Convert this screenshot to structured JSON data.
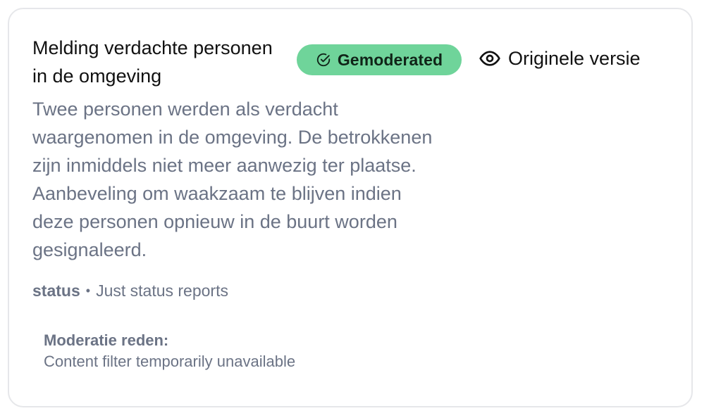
{
  "card": {
    "title": "Melding verdachte personen in de omgeving",
    "badge": {
      "label": "Gemoderated",
      "icon": "check-circle-icon",
      "color": "#6fd49a"
    },
    "original_link": {
      "label": "Originele versie",
      "icon": "eye-icon"
    },
    "body": "Twee personen werden als verdacht waargenomen in de omgeving. De betrokkenen zijn inmiddels niet meer aanwezig ter plaatse. Aanbeveling om waakzaam te blijven indien deze personen opnieuw in de buurt worden gesignaleerd.",
    "meta": {
      "key": "status",
      "separator": "•",
      "value": "Just status reports"
    },
    "moderation": {
      "label": "Moderatie reden:",
      "value": "Content filter temporarily unavailable"
    }
  },
  "colors": {
    "text_primary": "#111111",
    "text_muted": "#6b7385",
    "border": "#e6e7ea",
    "badge_bg": "#6fd49a"
  }
}
